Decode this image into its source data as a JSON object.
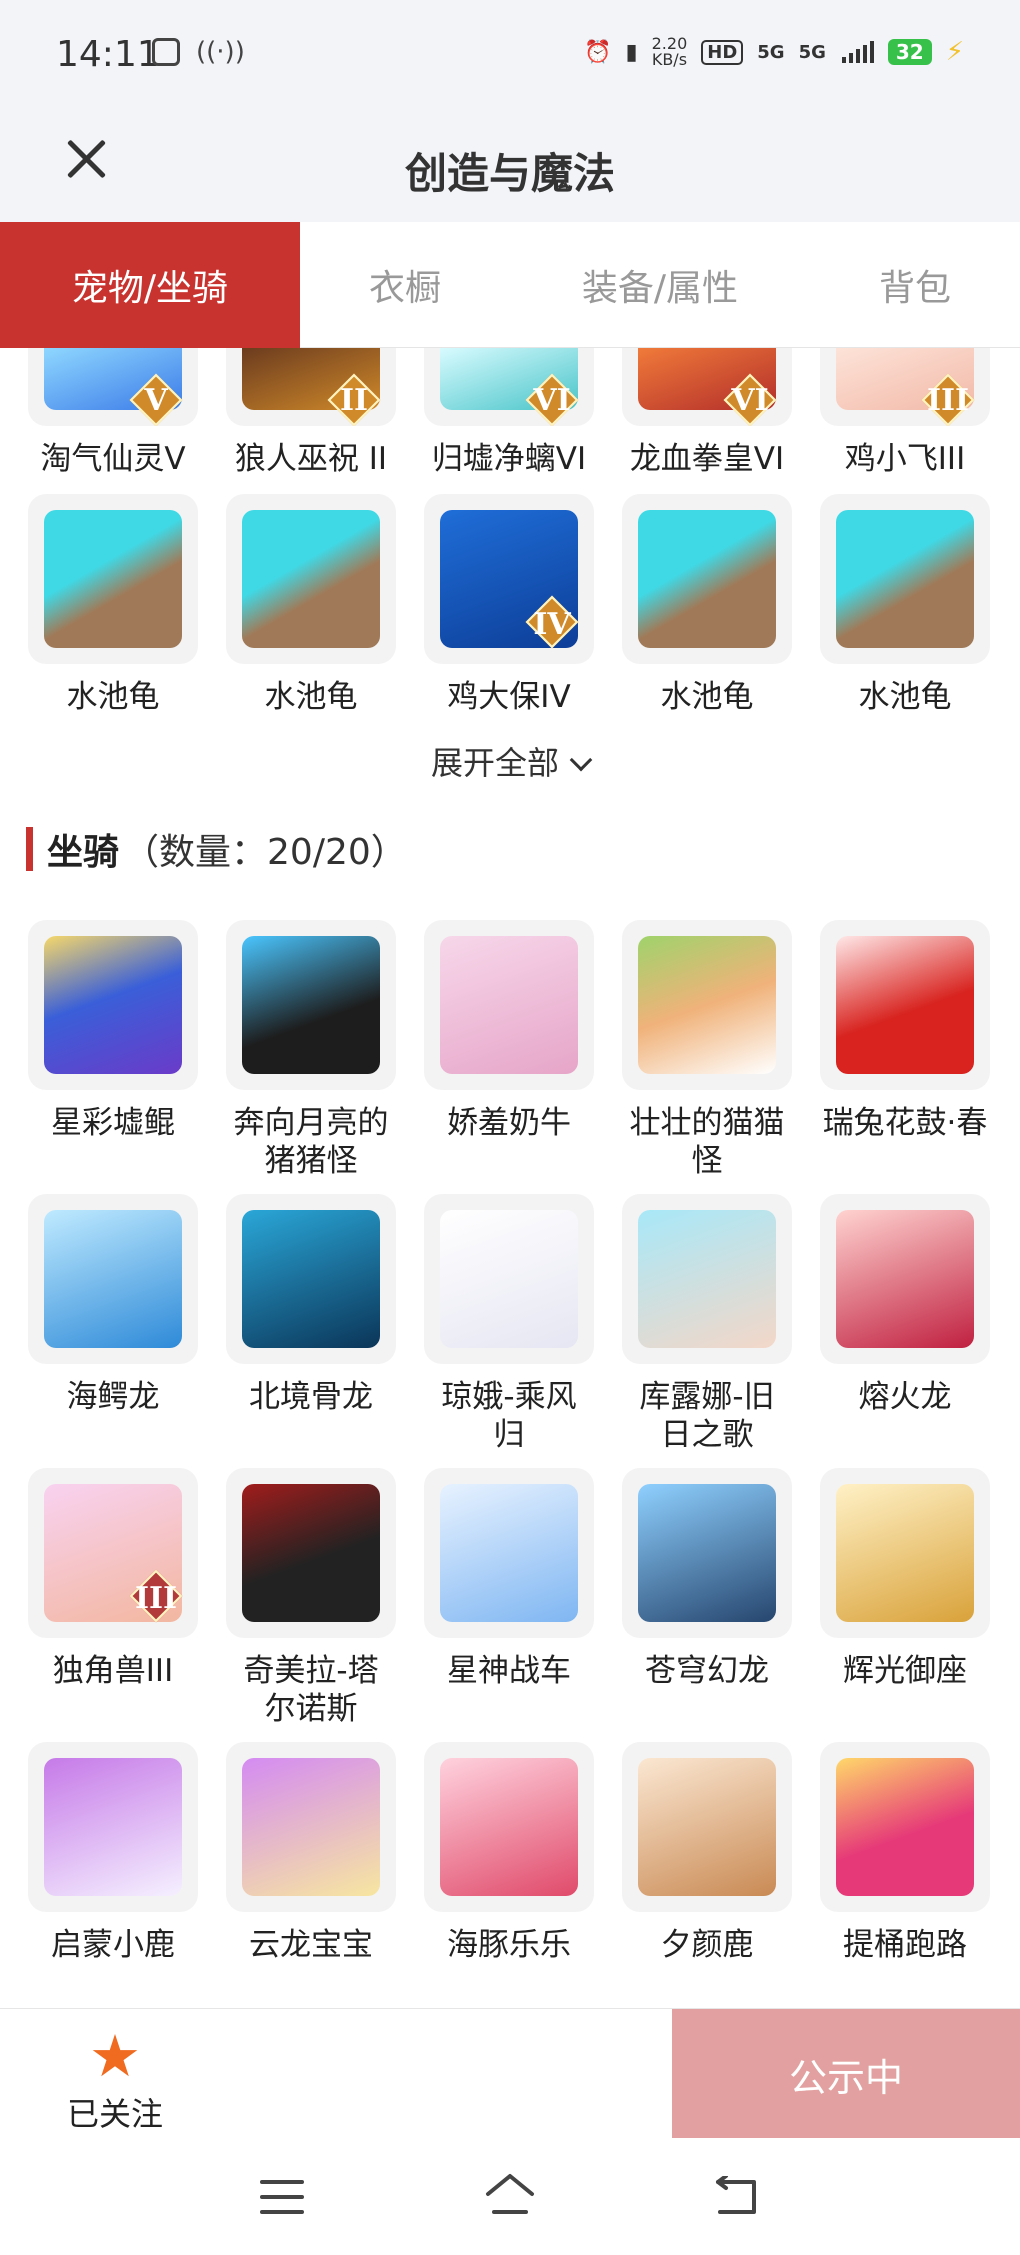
{
  "status_bar": {
    "time": "14:11",
    "speed_value": "2.20",
    "speed_unit": "KB/s",
    "hd_label": "HD",
    "net1": "5G",
    "net2": "5G",
    "battery": "32"
  },
  "header": {
    "title": "创造与魔法"
  },
  "tabs": [
    {
      "label": "宠物/坐骑",
      "active": true
    },
    {
      "label": "衣橱",
      "active": false
    },
    {
      "label": "装备/属性",
      "active": false
    },
    {
      "label": "背包",
      "active": false
    }
  ],
  "pets": {
    "partial_row": [
      {
        "name": "淘气仙灵V",
        "badge": "V",
        "icon": "blue-spirit-icon"
      },
      {
        "name": "狼人巫祝 II",
        "badge": "II",
        "icon": "werewolf-icon"
      },
      {
        "name": "归墟净螭VI",
        "badge": "VI",
        "icon": "water-dragon-icon"
      },
      {
        "name": "龙血拳皇VI",
        "badge": "VI",
        "icon": "fist-king-icon"
      },
      {
        "name": "鸡小飞III",
        "badge": "III",
        "icon": "chick-icon"
      }
    ],
    "row2": [
      {
        "name": "水池龟",
        "badge": "",
        "icon": "turtle-icon"
      },
      {
        "name": "水池龟",
        "badge": "",
        "icon": "turtle-icon"
      },
      {
        "name": "鸡大保IV",
        "badge": "IV",
        "icon": "blue-bird-icon"
      },
      {
        "name": "水池龟",
        "badge": "",
        "icon": "turtle-icon"
      },
      {
        "name": "水池龟",
        "badge": "",
        "icon": "turtle-icon"
      }
    ],
    "expand_label": "展开全部"
  },
  "mounts": {
    "section_name": "坐骑",
    "section_count": "（数量：20/20）",
    "rows": [
      [
        {
          "name": "星彩墟鲲",
          "badge": "",
          "icon": "whale-icon"
        },
        {
          "name": "奔向月亮的猪猪怪",
          "badge": "",
          "icon": "pig-icon"
        },
        {
          "name": "娇羞奶牛",
          "badge": "",
          "icon": "cow-icon"
        },
        {
          "name": "壮壮的猫猫怪",
          "badge": "",
          "icon": "cat-icon"
        },
        {
          "name": "瑞兔花鼓·春",
          "badge": "",
          "icon": "drum-icon"
        }
      ],
      [
        {
          "name": "海鳄龙",
          "badge": "",
          "icon": "sea-dragon-icon"
        },
        {
          "name": "北境骨龙",
          "badge": "",
          "icon": "bone-dragon-icon"
        },
        {
          "name": "琼娥-乘风归",
          "badge": "",
          "icon": "fairy-icon"
        },
        {
          "name": "库露娜-旧日之歌",
          "badge": "",
          "icon": "girl-icon"
        },
        {
          "name": "熔火龙",
          "badge": "",
          "icon": "lava-dragon-icon"
        }
      ],
      [
        {
          "name": "独角兽III",
          "badge": "III",
          "icon": "unicorn-icon"
        },
        {
          "name": "奇美拉-塔尔诺斯",
          "badge": "",
          "icon": "chimera-icon"
        },
        {
          "name": "星神战车",
          "badge": "",
          "icon": "chariot-icon"
        },
        {
          "name": "苍穹幻龙",
          "badge": "",
          "icon": "sky-dragon-icon"
        },
        {
          "name": "辉光御座",
          "badge": "",
          "icon": "throne-icon"
        }
      ],
      [
        {
          "name": "启蒙小鹿",
          "badge": "",
          "icon": "fawn-icon"
        },
        {
          "name": "云龙宝宝",
          "badge": "",
          "icon": "cloud-dragon-icon"
        },
        {
          "name": "海豚乐乐",
          "badge": "",
          "icon": "dolphin-icon"
        },
        {
          "name": "夕颜鹿",
          "badge": "",
          "icon": "deer-icon"
        },
        {
          "name": "提桶跑路",
          "badge": "",
          "icon": "bucket-icon"
        }
      ]
    ]
  },
  "bottom_bar": {
    "follow_label": "已关注",
    "publish_label": "公示中"
  },
  "colors": {
    "accent": "#c8332f",
    "publish_button": "#e2a1a0",
    "star": "#f06a1f"
  }
}
